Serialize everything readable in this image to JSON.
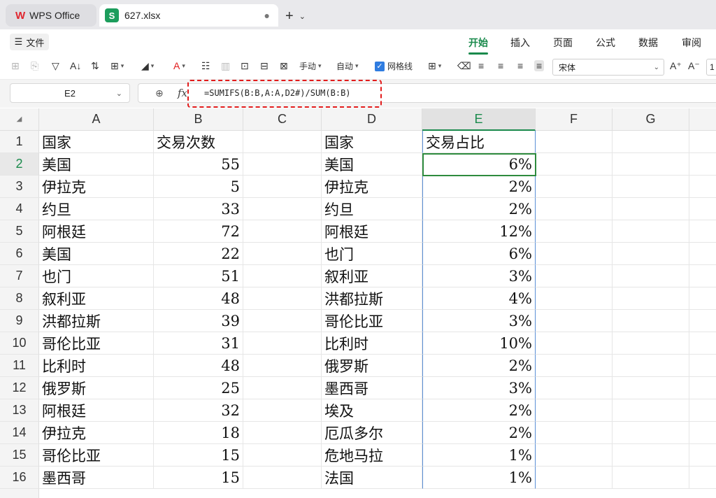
{
  "titlebar": {
    "app_tab_label": "WPS Office",
    "app_logo": "W",
    "file_tab_label": "627.xlsx",
    "file_logo": "S",
    "new_tab_symbol": "+"
  },
  "menubar": {
    "file_label": "文件",
    "items": [
      "开始",
      "插入",
      "页面",
      "公式",
      "数据",
      "审阅"
    ],
    "active": "开始"
  },
  "toolbar": {
    "manual_label": "手动",
    "auto_label": "自动",
    "gridlines_label": "网格线",
    "gridlines_checked": true,
    "font_name": "宋体",
    "font_size": "1"
  },
  "formula_bar": {
    "cell_ref": "E2",
    "fx_symbol": "fx",
    "formula": "=SUMIFS(B:B,A:A,D2#)/SUM(B:B)"
  },
  "sheet": {
    "columns": [
      "A",
      "B",
      "C",
      "D",
      "E",
      "F",
      "G"
    ],
    "active_column": "E",
    "active_row": 2,
    "rows": [
      {
        "n": "1",
        "A": "国家",
        "B": "交易次数",
        "C": "",
        "D": "国家",
        "E": "交易占比"
      },
      {
        "n": "2",
        "A": "美国",
        "B": "55",
        "C": "",
        "D": "美国",
        "E": "6%"
      },
      {
        "n": "3",
        "A": "伊拉克",
        "B": "5",
        "C": "",
        "D": "伊拉克",
        "E": "2%"
      },
      {
        "n": "4",
        "A": "约旦",
        "B": "33",
        "C": "",
        "D": "约旦",
        "E": "2%"
      },
      {
        "n": "5",
        "A": "阿根廷",
        "B": "72",
        "C": "",
        "D": "阿根廷",
        "E": "12%"
      },
      {
        "n": "6",
        "A": "美国",
        "B": "22",
        "C": "",
        "D": "也门",
        "E": "6%"
      },
      {
        "n": "7",
        "A": "也门",
        "B": "51",
        "C": "",
        "D": "叙利亚",
        "E": "3%"
      },
      {
        "n": "8",
        "A": "叙利亚",
        "B": "48",
        "C": "",
        "D": "洪都拉斯",
        "E": "4%"
      },
      {
        "n": "9",
        "A": "洪都拉斯",
        "B": "39",
        "C": "",
        "D": "哥伦比亚",
        "E": "3%"
      },
      {
        "n": "10",
        "A": "哥伦比亚",
        "B": "31",
        "C": "",
        "D": "比利时",
        "E": "10%"
      },
      {
        "n": "11",
        "A": "比利时",
        "B": "48",
        "C": "",
        "D": "俄罗斯",
        "E": "2%"
      },
      {
        "n": "12",
        "A": "俄罗斯",
        "B": "25",
        "C": "",
        "D": "墨西哥",
        "E": "3%"
      },
      {
        "n": "13",
        "A": "阿根廷",
        "B": "32",
        "C": "",
        "D": "埃及",
        "E": "2%"
      },
      {
        "n": "14",
        "A": "伊拉克",
        "B": "18",
        "C": "",
        "D": "厄瓜多尔",
        "E": "2%"
      },
      {
        "n": "15",
        "A": "哥伦比亚",
        "B": "15",
        "C": "",
        "D": "危地马拉",
        "E": "1%"
      },
      {
        "n": "16",
        "A": "墨西哥",
        "B": "15",
        "C": "",
        "D": "法国",
        "E": "1%"
      }
    ]
  }
}
